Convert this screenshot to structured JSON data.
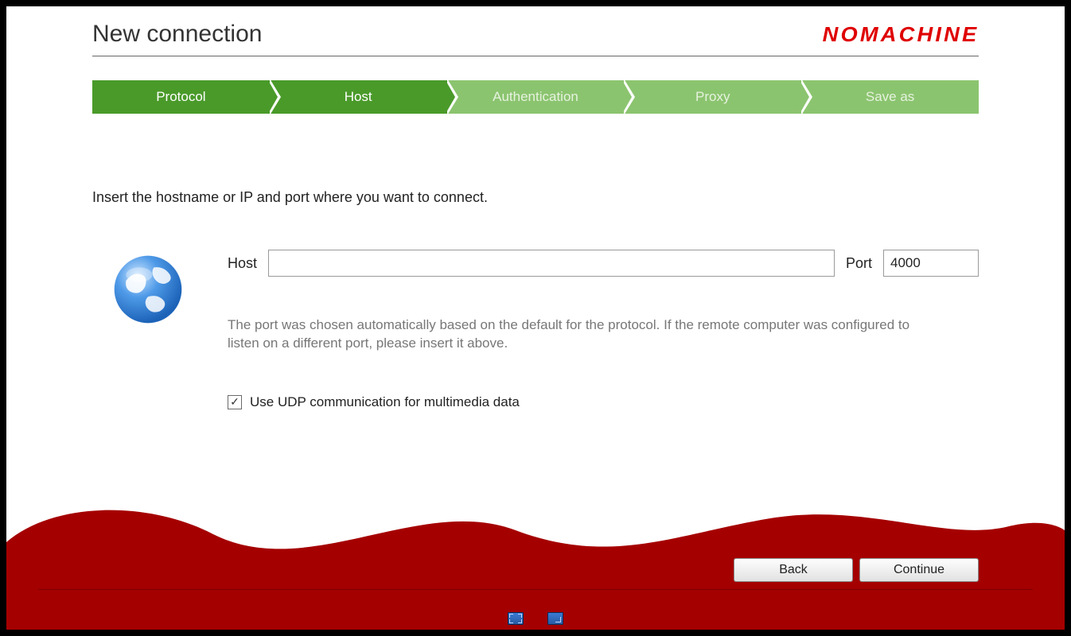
{
  "header": {
    "title": "New connection",
    "brand": "NOMACHINE"
  },
  "steps": [
    {
      "label": "Protocol",
      "state": "done"
    },
    {
      "label": "Host",
      "state": "active"
    },
    {
      "label": "Authentication",
      "state": "future"
    },
    {
      "label": "Proxy",
      "state": "future"
    },
    {
      "label": "Save as",
      "state": "future"
    }
  ],
  "instruction": "Insert the hostname or IP and port where you want to connect.",
  "form": {
    "host_label": "Host",
    "host_value": "",
    "port_label": "Port",
    "port_value": "4000",
    "hint": "The port was chosen automatically based on the default for the protocol. If the remote computer was configured to listen on a different port, please insert it above.",
    "udp_checked": true,
    "udp_label": "Use UDP communication for multimedia data"
  },
  "buttons": {
    "back": "Back",
    "continue": "Continue"
  },
  "icons": {
    "globe": "globe-icon",
    "fullscreen": "fullscreen-icon",
    "minimize": "minimize-window-icon"
  },
  "colors": {
    "brand_red": "#df0000",
    "step_active": "#4a9a2a",
    "step_future": "#8bc46f"
  }
}
